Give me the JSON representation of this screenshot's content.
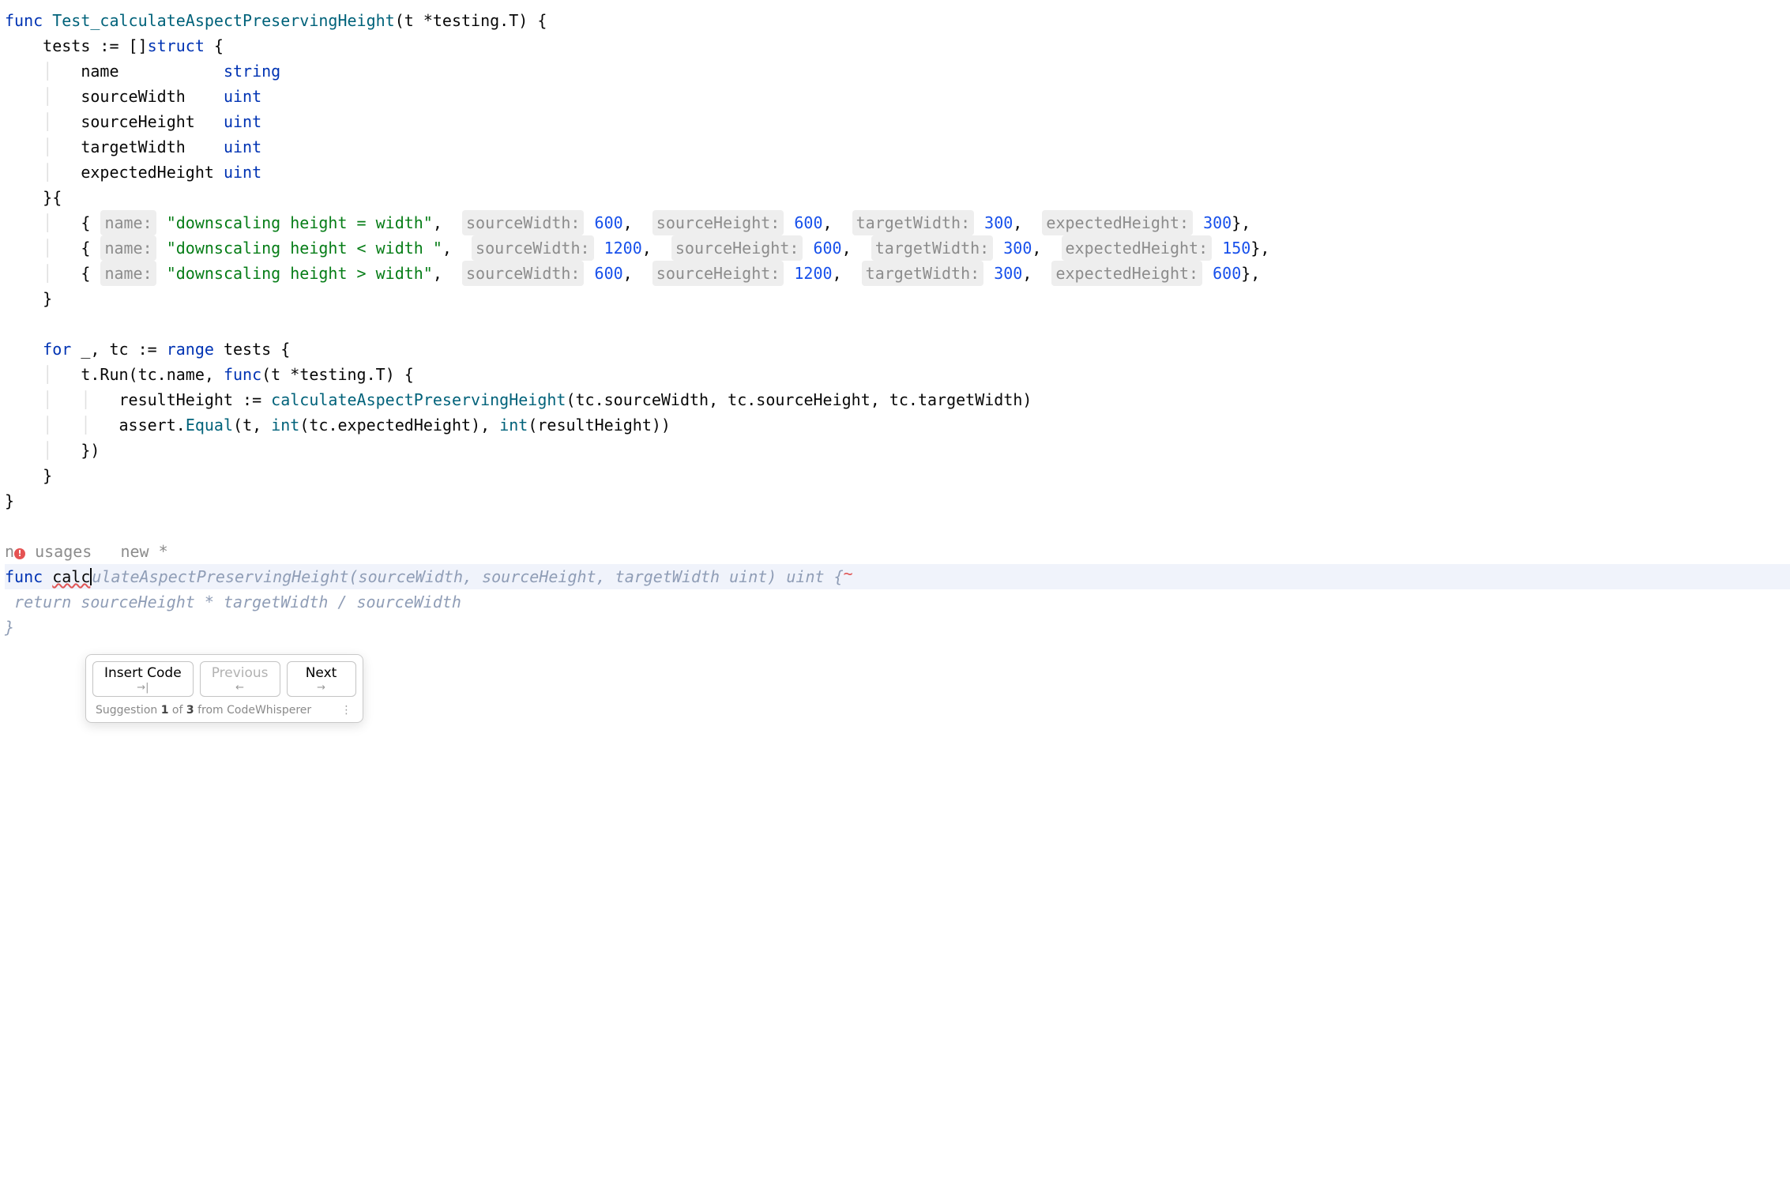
{
  "code": {
    "func_kw": "func",
    "test_fn": "Test_calculateAspectPreservingHeight",
    "param_t": "t ",
    "star": "*",
    "testing_type": "testing.T",
    "tests_assign": "tests := []",
    "struct_kw": "struct",
    "open": " {",
    "fields": {
      "name": "name           ",
      "name_t": "string",
      "sw": "sourceWidth    ",
      "sh": "sourceHeight   ",
      "tw": "targetWidth    ",
      "eh": "expectedHeight ",
      "uint": "uint"
    },
    "rows": [
      {
        "name_hint": "name:",
        "name_val": "\"downscaling height = width\"",
        "sw_hint": "sourceWidth:",
        "sw": "600",
        "sh_hint": "sourceHeight:",
        "sh": "600",
        "tw_hint": "targetWidth:",
        "tw": "300",
        "eh_hint": "expectedHeight:",
        "eh": "300"
      },
      {
        "name_hint": "name:",
        "name_val": "\"downscaling height < width \"",
        "sw_hint": "sourceWidth:",
        "sw": "1200",
        "sh_hint": "sourceHeight:",
        "sh": "600",
        "tw_hint": "targetWidth:",
        "tw": "300",
        "eh_hint": "expectedHeight:",
        "eh": "150"
      },
      {
        "name_hint": "name:",
        "name_val": "\"downscaling height > width\"",
        "sw_hint": "sourceWidth:",
        "sw": "600",
        "sh_hint": "sourceHeight:",
        "sh": "1200",
        "tw_hint": "targetWidth:",
        "tw": "300",
        "eh_hint": "expectedHeight:",
        "eh": "600"
      }
    ],
    "for_kw": "for",
    "for_rest": " _, tc := ",
    "range_kw": "range",
    "range_expr": " tests {",
    "run_line_a": "t.Run(tc.name, ",
    "func_kw2": "func",
    "run_line_b": "(t *",
    "run_line_c": ") {",
    "result_assign": "resultHeight := ",
    "calc_call": "calculateAspectPreservingHeight",
    "calc_args": "(tc.sourceWidth, tc.sourceHeight, tc.targetWidth)",
    "assert_a": "assert.",
    "assert_fn": "Equal",
    "assert_b": "(t, ",
    "int1": "int",
    "assert_c": "(tc.expectedHeight), ",
    "int2": "int",
    "assert_d": "(resultHeight))",
    "close_run": "})",
    "close_for": "}",
    "close_func": "}"
  },
  "annotations": {
    "no_usages_prefix": "n",
    "no_usages_suffix": " usages",
    "new_marker": "new *",
    "error_badge": "!"
  },
  "typing": {
    "func_kw": "func",
    "typed": "calc",
    "ghost_sig": "ulateAspectPreservingHeight(sourceWidth, sourceHeight, targetWidth uint) uint {",
    "wave": "~",
    "ghost_body": " return sourceHeight * targetWidth / sourceWidth",
    "ghost_close": "}"
  },
  "toolbar": {
    "insert": "Insert Code",
    "insert_sub": "→|",
    "prev": "Previous",
    "prev_sub": "←",
    "next": "Next",
    "next_sub": "→",
    "status_a": "Suggestion ",
    "status_idx": "1",
    "status_b": " of ",
    "status_total": "3",
    "status_c": " from CodeWhisperer",
    "dots": "⋮"
  }
}
